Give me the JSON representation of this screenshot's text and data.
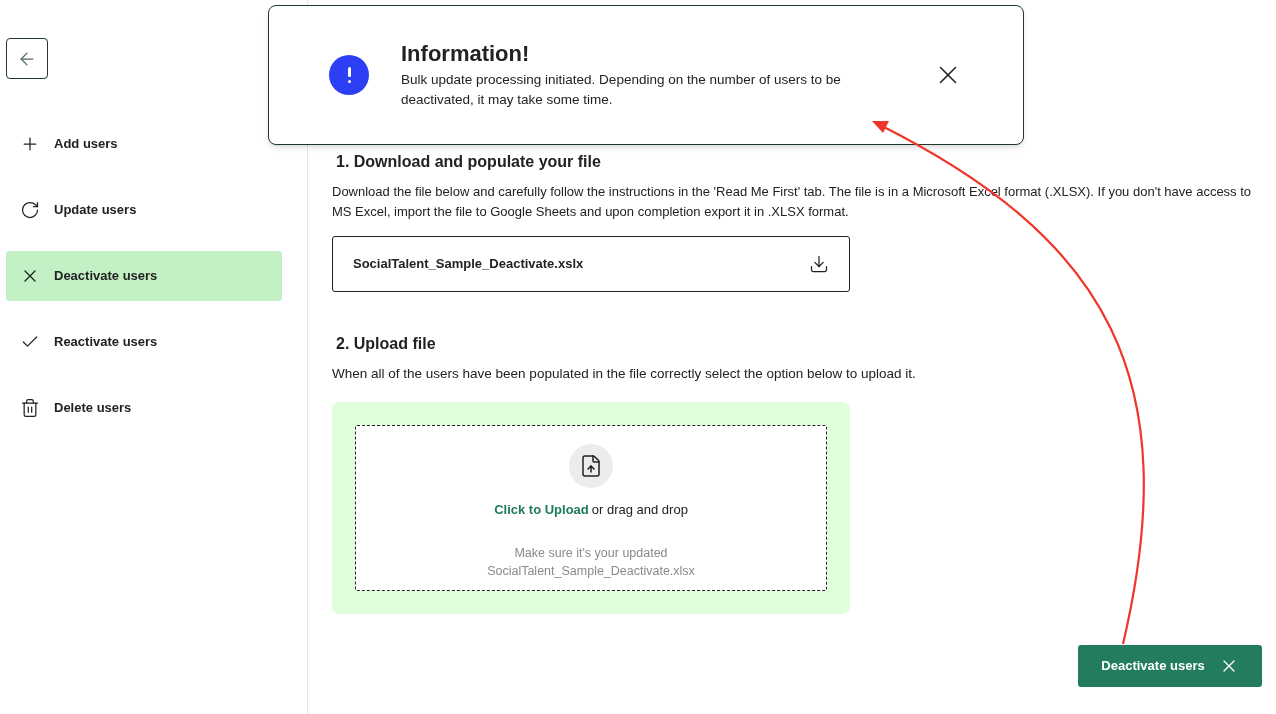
{
  "sidebar": {
    "items": [
      {
        "kind": "add",
        "label": "Add users",
        "selected": false
      },
      {
        "kind": "update",
        "label": "Update users",
        "selected": false
      },
      {
        "kind": "deactivate",
        "label": "Deactivate users",
        "selected": true
      },
      {
        "kind": "reactivate",
        "label": "Reactivate users",
        "selected": false
      },
      {
        "kind": "delete",
        "label": "Delete users",
        "selected": false
      }
    ]
  },
  "toast": {
    "title": "Information!",
    "message": "Bulk update processing initiated. Depending on the number of users to be deactivated, it may take some time."
  },
  "step1": {
    "heading": "1. Download and populate your file",
    "description": "Download the file below and carefully follow the instructions in the 'Read Me First' tab. The file is in a Microsoft Excel format (.XLSX). If you don't have access to MS Excel, import the file to Google Sheets and upon completion export it in .XLSX format.",
    "file_name": "SocialTalent_Sample_Deactivate.xslx"
  },
  "step2": {
    "heading": "2. Upload file",
    "description": "When all of the users have been populated in the file correctly select the option below to upload it.",
    "upload_link": "Click to Upload",
    "upload_text": "or drag and drop",
    "hint": "Make sure it's your updated SocialTalent_Sample_Deactivate.xlsx"
  },
  "action_button": {
    "label": "Deactivate users"
  }
}
